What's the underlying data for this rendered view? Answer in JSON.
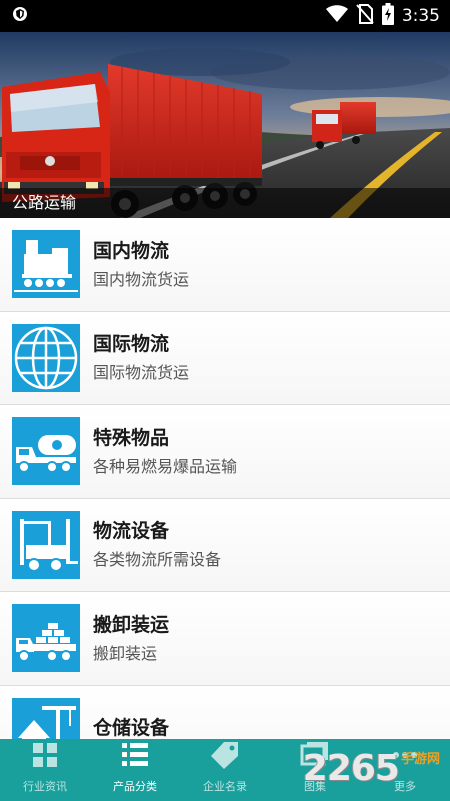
{
  "status_bar": {
    "time": "3:35",
    "icons": [
      "shield-icon",
      "wifi-icon",
      "no-sim-icon",
      "battery-charging-icon"
    ]
  },
  "banner": {
    "caption": "公路运输",
    "image": "red-trucks-on-highway"
  },
  "list": {
    "items": [
      {
        "title": "国内物流",
        "subtitle": "国内物流货运",
        "icon": "train-icon"
      },
      {
        "title": "国际物流",
        "subtitle": "国际物流货运",
        "icon": "globe-icon"
      },
      {
        "title": "特殊物品",
        "subtitle": "各种易燃易爆品运输",
        "icon": "tanker-truck-icon"
      },
      {
        "title": "物流设备",
        "subtitle": "各类物流所需设备",
        "icon": "forklift-icon"
      },
      {
        "title": "搬卸装运",
        "subtitle": "搬卸装运",
        "icon": "flatbed-truck-icon"
      },
      {
        "title": "仓储设备",
        "subtitle": "",
        "icon": "warehouse-crane-icon"
      }
    ]
  },
  "bottom_nav": {
    "tabs": [
      {
        "label": "行业资讯",
        "icon": "grid-icon",
        "active": false
      },
      {
        "label": "产品分类",
        "icon": "list-icon",
        "active": true
      },
      {
        "label": "企业名录",
        "icon": "tag-icon",
        "active": false
      },
      {
        "label": "图集",
        "icon": "gallery-icon",
        "active": false
      },
      {
        "label": "更多",
        "icon": "more-icon",
        "active": false
      }
    ]
  },
  "watermark": {
    "number": "2265",
    "site": "手游网",
    "suffix": ".com"
  },
  "colors": {
    "accent": "#1aa09c",
    "icon_bg": "#1a9fd8"
  }
}
